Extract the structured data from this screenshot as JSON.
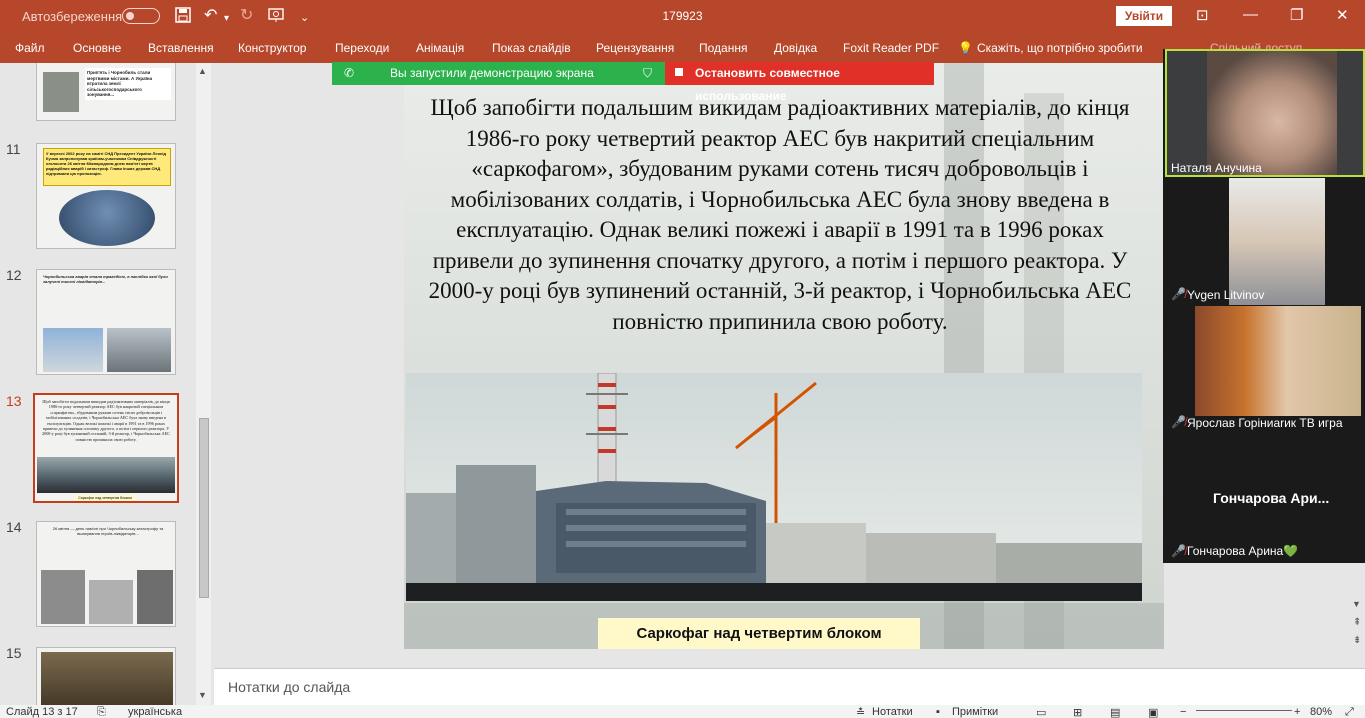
{
  "titlebar": {
    "autosave_label": "Автозбереження",
    "doc_title": "179923",
    "signin_label": "Увійти"
  },
  "ribbon": {
    "items": [
      "Файл",
      "Основне",
      "Вставлення",
      "Конструктор",
      "Переходи",
      "Анімація",
      "Показ слайдів",
      "Рецензування",
      "Подання",
      "Довідка",
      "Foxit Reader PDF",
      "Скажіть, що потрібно зробити",
      "Спільний доступ"
    ]
  },
  "thumbnails": {
    "numbers": [
      "11",
      "12",
      "13",
      "14",
      "15"
    ],
    "active_number": "13",
    "thumb11_text": "У вересні 2002 року на саміті СНД Президент України Леонід Кучма запропонував країнам-учасникам Співдружності оголосити 26 квітня Міжнародним днем пам'яті жертв радіаційних аварій і катастроф. Глави інших держав СНД підтримали цю пропозицію.",
    "thumb10_text": "Прип'ять і Чорнобиль стали мертвими містами. А Україна втратила землі сільськогосподарського зонування...",
    "thumb12_text": "Чорнобильська аварія стала трагедією, в наслідки якої були залучені тисячі ліквідаторів...",
    "thumb14_text": "26 квітня — день пам'яті про Чорнобильську катастрофу та вшанування героїв-ліквідаторів...",
    "thumb13_caption": "Саркофаг над четвертим блоком"
  },
  "share": {
    "green_label": "Вы запустили демонстрацию экрана",
    "red_label": "Остановить совместное использование"
  },
  "slide": {
    "text": "Щоб запобігти подальшим викидам радіоактивних матеріалів, до кінця 1986-го року четвертий реактор АЕС був накритий спеціальним «саркофагом», збудованим руками сотень тисяч добровольців і мобілізованих солдатів, і Чорнобильська АЕС була знову введена в експлуатацію. Однак великі пожежі і аварії в 1991 та в 1996 роках привели до зупинення спочатку другого, а потім і першого реактора. У 2000-у році був зупинений останній, 3-й реактор, і Чорнобильська АЕС повністю припинила свою роботу.",
    "caption": "Саркофаг над четвертим блоком"
  },
  "participants": [
    {
      "name": "Наталя Анучина",
      "muted": false
    },
    {
      "name": "Yvgen Litvinov",
      "muted": true
    },
    {
      "name": "Ярослав Горіниarик ТВ игра",
      "muted": true
    },
    {
      "name": "Гончарова Арина💚",
      "muted": true,
      "display_short": "Гончарова  Ари..."
    }
  ],
  "notes": {
    "placeholder": "Нотатки до слайда"
  },
  "statusbar": {
    "slide_info": "Слайд 13 з 17",
    "language": "українська",
    "notes_label": "Нотатки",
    "comments_label": "Примітки",
    "zoom": "80%"
  },
  "colors": {
    "accent": "#b7472a",
    "share_green": "#2bb24c",
    "share_red": "#e03028",
    "caption_bg": "#fff8c9"
  }
}
